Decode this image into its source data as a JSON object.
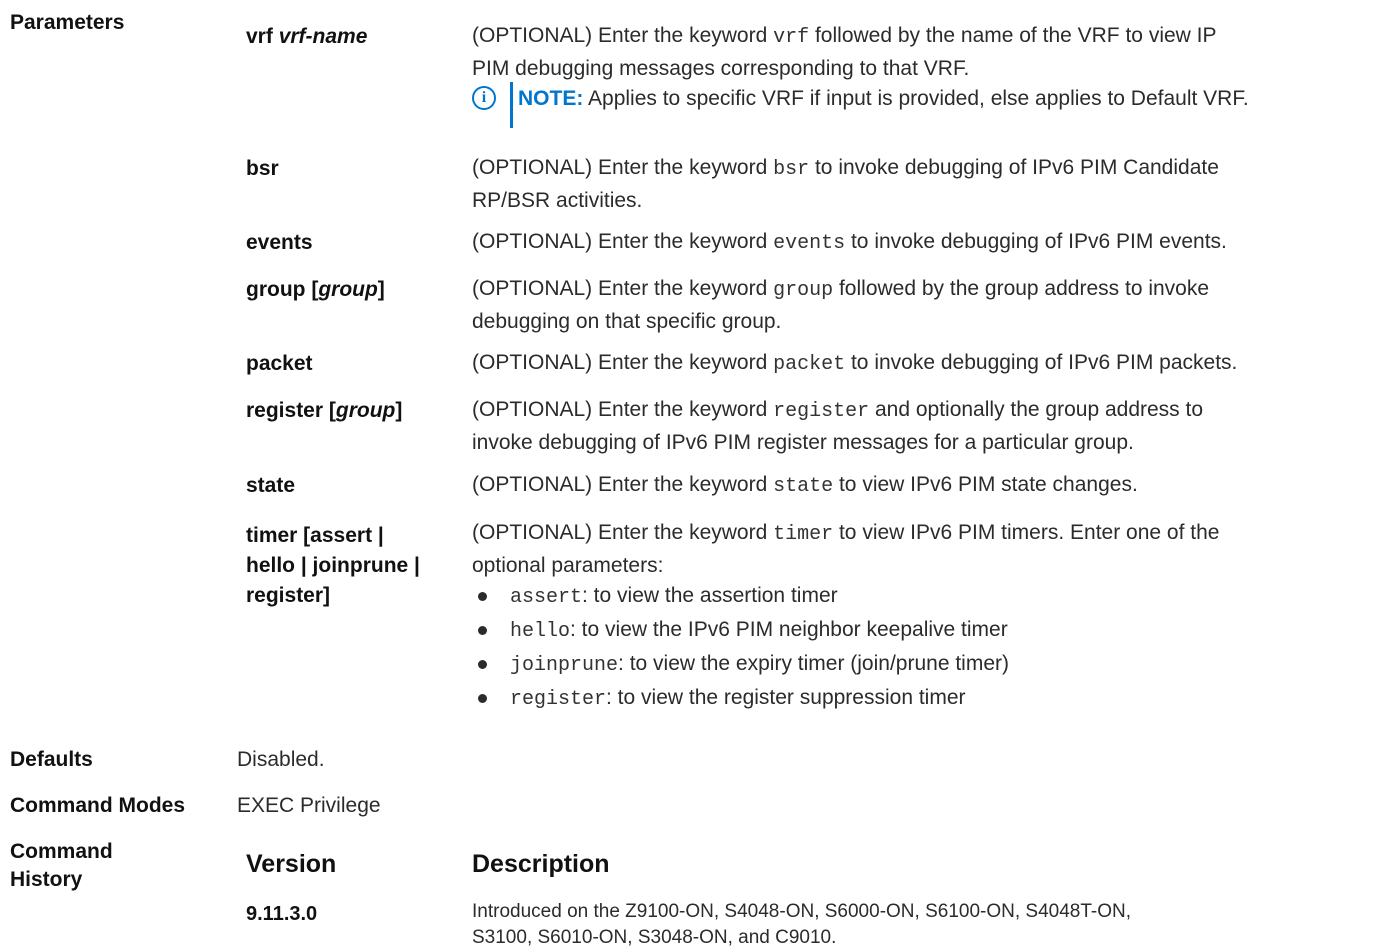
{
  "labels": {
    "parameters": "Parameters",
    "defaults": "Defaults",
    "command_modes": "Command Modes",
    "command_history_1": "Command",
    "command_history_2": "History"
  },
  "params": {
    "vrf": {
      "kw": "vrf",
      "arg": "vrf-name",
      "d1": "(OPTIONAL) Enter the keyword",
      "code": "vrf",
      "d2": "followed by the name of the VRF to view IP",
      "d3": "PIM debugging messages corresponding to that VRF."
    },
    "note": {
      "icon": "info-icon",
      "label": "NOTE:",
      "text": "Applies to specific VRF if input is provided, else applies to Default VRF."
    },
    "bsr": {
      "kw": "bsr",
      "d1": "(OPTIONAL) Enter the keyword",
      "code": "bsr",
      "d2": "to invoke debugging of IPv6 PIM Candidate",
      "d3": "RP/BSR activities."
    },
    "events": {
      "kw": "events",
      "d1": "(OPTIONAL) Enter the keyword",
      "code": "events",
      "d2": "to invoke debugging of IPv6 PIM events."
    },
    "group": {
      "kw": "group [",
      "arg": "group",
      "kw2": "]",
      "d1": "(OPTIONAL) Enter the keyword",
      "code": "group",
      "d2": "followed by the group address to invoke",
      "d3": "debugging on that specific group."
    },
    "packet": {
      "kw": "packet",
      "d1": "(OPTIONAL) Enter the keyword",
      "code": "packet",
      "d2": "to invoke debugging of IPv6 PIM packets."
    },
    "register": {
      "kw": "register [",
      "arg": "group",
      "kw2": "]",
      "d1": "(OPTIONAL) Enter the keyword",
      "code": "register",
      "d2": "and optionally the group address to",
      "d3": "invoke debugging of IPv6 PIM register messages for a particular group."
    },
    "state": {
      "kw": "state",
      "d1": "(OPTIONAL) Enter the keyword",
      "code": "state",
      "d2": "to view IPv6 PIM state changes."
    },
    "timer": {
      "kw1": "timer [assert |",
      "kw2": "hello | joinprune |",
      "kw3": "register]",
      "d1": "(OPTIONAL) Enter the keyword",
      "code": "timer",
      "d2": "to view IPv6 PIM timers. Enter one of the",
      "d3": "optional parameters:",
      "bullets": [
        {
          "code": "assert",
          "text": ": to view the assertion timer"
        },
        {
          "code": "hello",
          "text": ": to view the IPv6 PIM neighbor keepalive timer"
        },
        {
          "code": "joinprune",
          "text": ": to view the expiry timer (join/prune timer)"
        },
        {
          "code": "register",
          "text": ": to view the register suppression timer"
        }
      ]
    }
  },
  "defaults_value": "Disabled.",
  "command_modes_value": "EXEC Privilege",
  "history": {
    "col_version": "Version",
    "col_description": "Description",
    "rows": [
      {
        "version": "9.11.3.0",
        "d1": "Introduced on the Z9100-ON, S4048-ON, S6000-ON, S6100-ON, S4048T-ON,",
        "d2": "S3100, S6010-ON, S3048-ON, and C9010."
      }
    ]
  }
}
